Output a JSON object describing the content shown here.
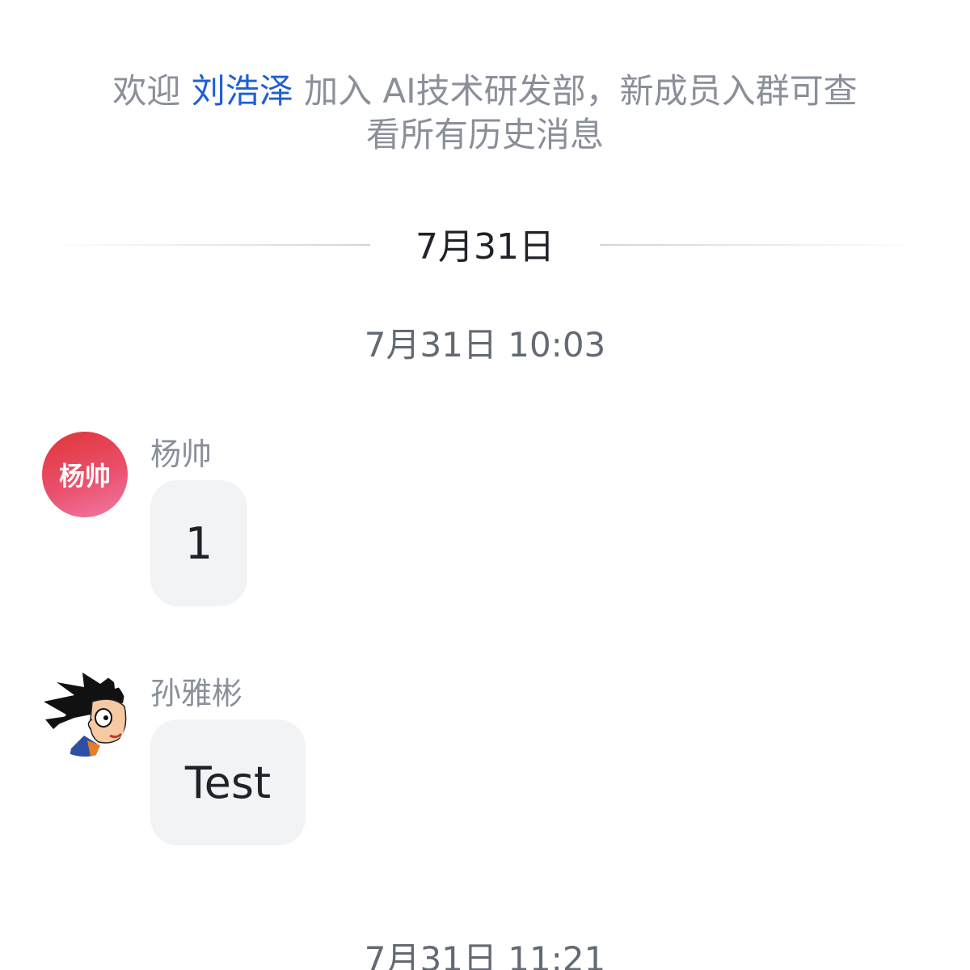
{
  "system_notice": {
    "prefix": "欢迎 ",
    "user": "刘浩泽",
    "suffix": " 加入 AI技术研发部，新成员入群可查看所有历史消息"
  },
  "date_divider": {
    "label": "7月31日"
  },
  "timestamps": [
    "7月31日 10:03",
    "7月31日 11:21"
  ],
  "messages": [
    {
      "sender": "杨帅",
      "avatar_text": "杨帅",
      "text": "1"
    },
    {
      "sender": "孙雅彬",
      "avatar_icon": "cartoon-character-avatar",
      "text": "Test"
    }
  ],
  "colors": {
    "link": "#1f5fd6",
    "muted_text": "#8a8f99",
    "bubble_bg": "#f2f3f5"
  }
}
